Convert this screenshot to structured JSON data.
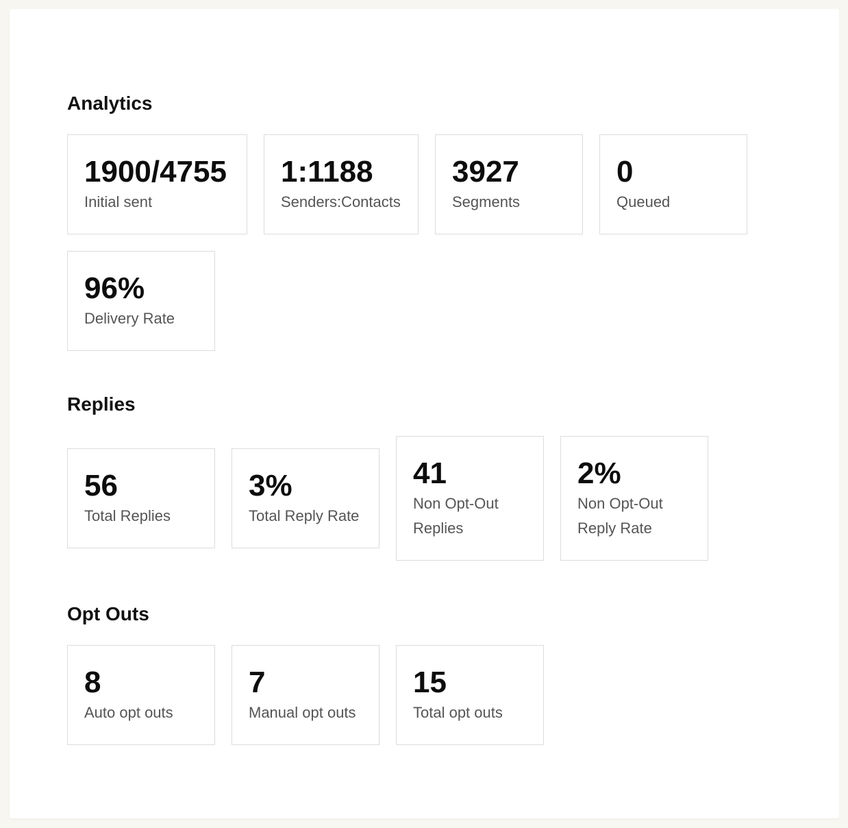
{
  "sections": {
    "analytics": {
      "title": "Analytics",
      "cards": [
        {
          "value": "1900/4755",
          "label": "Initial sent"
        },
        {
          "value": "1:1188",
          "label": "Senders:Contacts"
        },
        {
          "value": "3927",
          "label": "Segments"
        },
        {
          "value": "0",
          "label": "Queued"
        },
        {
          "value": "96%",
          "label": "Delivery Rate"
        }
      ]
    },
    "replies": {
      "title": "Replies",
      "cards": [
        {
          "value": "56",
          "label": "Total Replies"
        },
        {
          "value": "3%",
          "label": "Total Reply Rate"
        },
        {
          "value": "41",
          "label": "Non Opt-Out Replies"
        },
        {
          "value": "2%",
          "label": "Non Opt-Out Reply Rate"
        }
      ]
    },
    "opt_outs": {
      "title": "Opt Outs",
      "cards": [
        {
          "value": "8",
          "label": "Auto opt outs"
        },
        {
          "value": "7",
          "label": "Manual opt outs"
        },
        {
          "value": "15",
          "label": "Total opt outs"
        }
      ]
    }
  }
}
